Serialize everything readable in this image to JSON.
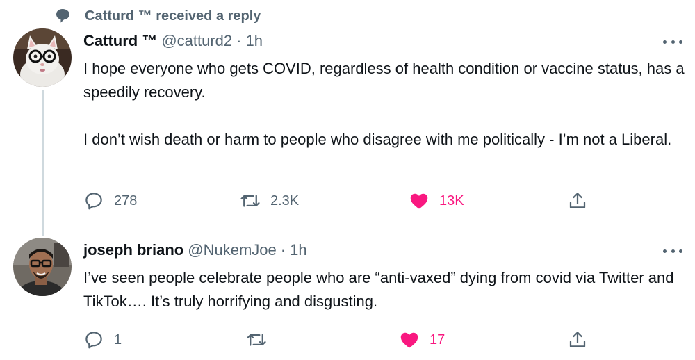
{
  "context": {
    "text": "Catturd ™ received a reply",
    "icon": "speech-bubble-icon"
  },
  "tweets": [
    {
      "name": "Catturd ™",
      "handle": "@catturd2",
      "dot": "·",
      "time": "1h",
      "text": "I hope everyone who gets COVID, regardless of health condition or vaccine status, has a speedily recovery.\n\nI don’t wish death or harm to people who disagree with me politically - I’m not a Liberal.",
      "replies": "278",
      "retweets": "2.3K",
      "likes": "13K",
      "liked": true
    },
    {
      "name": "joseph briano",
      "handle": "@NukemJoe",
      "dot": "·",
      "time": "1h",
      "text": "I’ve seen people celebrate people who are “anti-vaxed” dying from covid via Twitter and TikTok…. It’s truly horrifying and disgusting.",
      "replies": "1",
      "retweets": "",
      "likes": "17",
      "liked": true
    }
  ],
  "colors": {
    "like": "#f91880",
    "secondary_text": "#536471",
    "primary_text": "#0f1419",
    "thread_line": "#cfd9de"
  }
}
